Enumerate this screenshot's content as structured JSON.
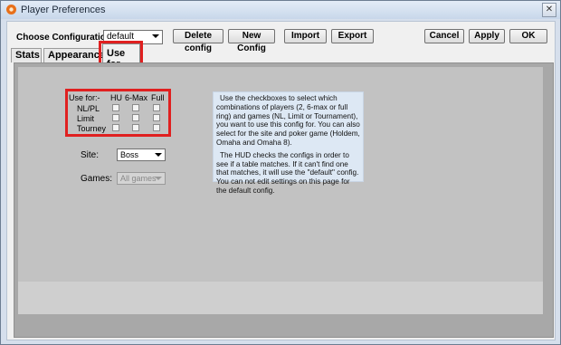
{
  "window": {
    "title": "Player Preferences",
    "close_glyph": "✕",
    "icon": "app-icon"
  },
  "config": {
    "label": "Choose Configuration:",
    "selected": "default"
  },
  "buttons": {
    "delete_config": "Delete config",
    "new_config": "New Config",
    "import": "Import",
    "export": "Export",
    "cancel": "Cancel",
    "apply": "Apply",
    "ok": "OK"
  },
  "tabs": [
    {
      "label": "Stats",
      "active": false
    },
    {
      "label": "Appearance",
      "active": false
    },
    {
      "label": "Use for",
      "active": true
    }
  ],
  "use_for": {
    "header": "Use for:-",
    "columns": [
      "HU",
      "6-Max",
      "Full"
    ],
    "rows": [
      "NL/PL",
      "Limit",
      "Tourney"
    ]
  },
  "site": {
    "label": "Site:",
    "selected": "Boss"
  },
  "games": {
    "label": "Games:",
    "selected": "All games"
  },
  "help": {
    "paragraph1": "Use the checkboxes to select which combinations of players (2, 6-max or full ring) and games (NL, Limit or Tournament), you want to use this config for. You can also select for the site and poker game (Holdem, Omaha and Omaha 8).",
    "paragraph2": "The HUD checks the configs in order to see if a table matches. If it can't find one that matches, it will use the \"default\" config. You can not edit settings on this page for the default config."
  },
  "colors": {
    "highlight": "#e02020",
    "panel_bg": "#c2c2c2",
    "help_bg": "#dde8f4"
  }
}
